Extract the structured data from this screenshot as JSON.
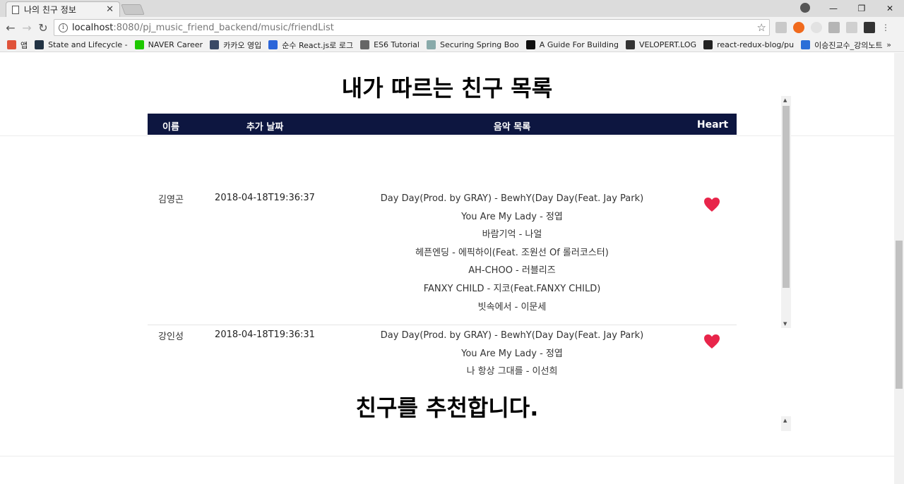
{
  "browser": {
    "tab_title": "나의 친구 정보",
    "url_host": "localhost",
    "url_rest": ":8080/pj_music_friend_backend/music/friendList",
    "bookmarks": [
      {
        "label": "앱",
        "color": "#e0533a"
      },
      {
        "label": "State and Lifecycle -",
        "color": "#223344"
      },
      {
        "label": "NAVER Career",
        "color": "#1ec800"
      },
      {
        "label": "카카오 영입",
        "color": "#3a4a66"
      },
      {
        "label": "순수 React.js로 로그",
        "color": "#2b65d9"
      },
      {
        "label": "ES6 Tutorial",
        "color": "#666"
      },
      {
        "label": "Securing Spring Boo",
        "color": "#8aa"
      },
      {
        "label": "A Guide For Building",
        "color": "#111"
      },
      {
        "label": "VELOPERT.LOG",
        "color": "#333"
      },
      {
        "label": "react-redux-blog/pu",
        "color": "#222"
      },
      {
        "label": "이승진교수_강의노트",
        "color": "#2a6ed8"
      }
    ],
    "more": "»"
  },
  "page": {
    "heading_following": "내가 따르는 친구 목록",
    "heading_recommend": "친구를 추천합니다."
  },
  "table": {
    "headers": {
      "name": "이름",
      "date": "추가 날짜",
      "music": "음악 목록",
      "heart": "Heart"
    },
    "rows": [
      {
        "name": "김영곤",
        "date": "2018-04-18T19:36:37",
        "songs": [
          "Day Day(Prod. by GRAY) - BewhY(Day Day(Feat. Jay Park)",
          "You Are My Lady - 정엽",
          "바람기억 - 나얼",
          "헤픈엔딩 - 에픽하이(Feat. 조원선 Of 롤러코스터)",
          "AH-CHOO - 러블리즈",
          "FANXY CHILD - 지코(Feat.FANXY CHILD)",
          "빗속에서 - 이문세"
        ]
      },
      {
        "name": "강인성",
        "date": "2018-04-18T19:36:31",
        "songs": [
          "Day Day(Prod. by GRAY) - BewhY(Day Day(Feat. Jay Park)",
          "You Are My Lady - 정엽",
          "나 항상 그대를 - 이선희"
        ]
      }
    ],
    "heart_color": "#e8254a",
    "header_bg": "#0d1640"
  }
}
